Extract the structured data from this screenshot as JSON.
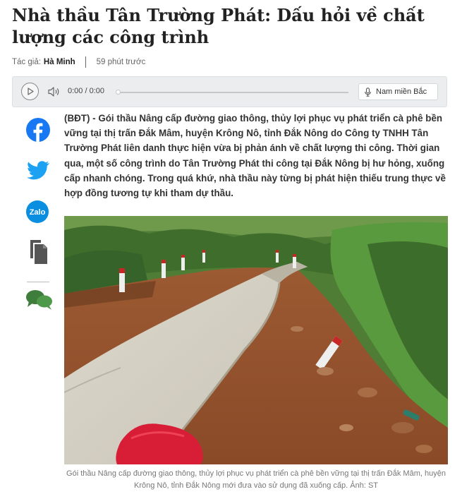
{
  "article": {
    "title": "Nhà thầu Tân Trường Phát: Dấu hỏi về chất lượng các công trình",
    "author_label": "Tác giả:",
    "author_name": "Hà Minh",
    "time_ago": "59 phút trước",
    "lead": "(BĐT) - Gói thầu Nâng cấp đường giao thông, thủy lợi phục vụ phát triển cà phê bền vững tại thị trấn Đắk Mâm, huyện Krông Nô, tỉnh Đắk Nông do Công ty TNHH Tân Trường Phát liên danh thực hiện vừa bị phản ánh về chất lượng thi công. Thời gian qua, một số công trình do Tân Trường Phát thi công tại Đắk Nông bị hư hỏng, xuống cấp nhanh chóng. Trong quá khứ, nhà thầu này từng bị phát hiện thiếu trung thực về hợp đồng tương tự khi tham dự thầu.",
    "image_caption": "Gói thầu Nâng cấp đường giao thông, thủy lợi phục vụ phát triển cà phê bền vững tại thị trấn Đắk Mâm, huyện Krông Nô, tỉnh Đắk Nông mới đưa vào sử dụng đã xuống cấp. Ảnh: ST"
  },
  "audio_player": {
    "time": "0:00 / 0:00",
    "progress": 0,
    "voice_label": "Nam miền Bắc",
    "icons": [
      "play-icon",
      "volume-icon",
      "microphone-icon"
    ]
  },
  "share": {
    "icons": [
      "facebook-icon",
      "twitter-icon",
      "zalo-icon",
      "copy-icon",
      "comment-icon"
    ],
    "zalo_label": "Zalo",
    "colors": {
      "facebook": "#1877f2",
      "twitter": "#1da1f2",
      "zalo": "#0a8fe0",
      "copy": "#555555",
      "comment": "#3e7d3c"
    }
  }
}
